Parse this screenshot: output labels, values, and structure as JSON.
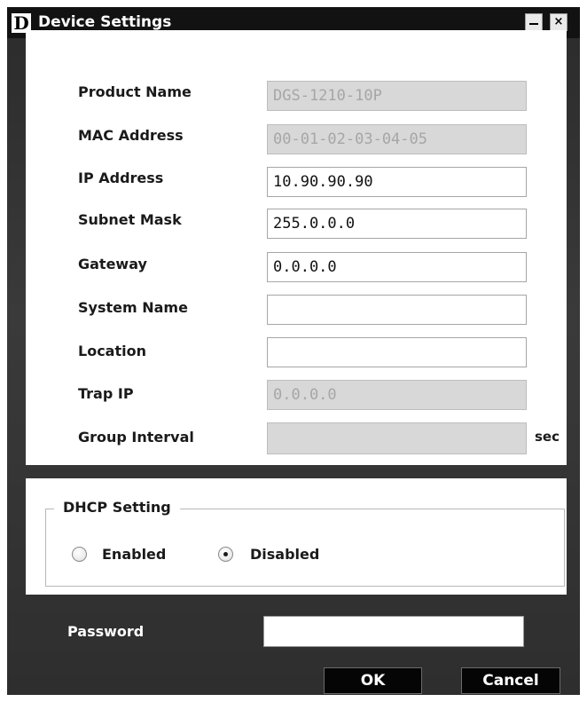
{
  "window": {
    "title": "Device Settings",
    "logo_letter": "D",
    "close_glyph": "×"
  },
  "fields": [
    {
      "label": "Product Name",
      "value": "DGS-1210-10P"
    },
    {
      "label": "MAC Address",
      "value": "00-01-02-03-04-05"
    },
    {
      "label": "IP Address",
      "value": "10.90.90.90"
    },
    {
      "label": "Subnet Mask",
      "value": "255.0.0.0"
    },
    {
      "label": "Gateway",
      "value": "0.0.0.0"
    },
    {
      "label": "System Name",
      "value": ""
    },
    {
      "label": "Location",
      "value": ""
    },
    {
      "label": "Trap IP",
      "value": "0.0.0.0"
    },
    {
      "label": "Group Interval",
      "value": ""
    }
  ],
  "group_interval_unit": "sec",
  "dhcp": {
    "legend": "DHCP Setting",
    "options": [
      "Enabled",
      "Disabled"
    ],
    "selected": "Disabled"
  },
  "password": {
    "label": "Password",
    "value": ""
  },
  "buttons": {
    "ok": "OK",
    "cancel": "Cancel"
  },
  "colors": {
    "title_bar": "#121212",
    "window_bg": "#333333",
    "panel_bg": "#ffffff",
    "disabled_field": "#d8d8d8"
  }
}
